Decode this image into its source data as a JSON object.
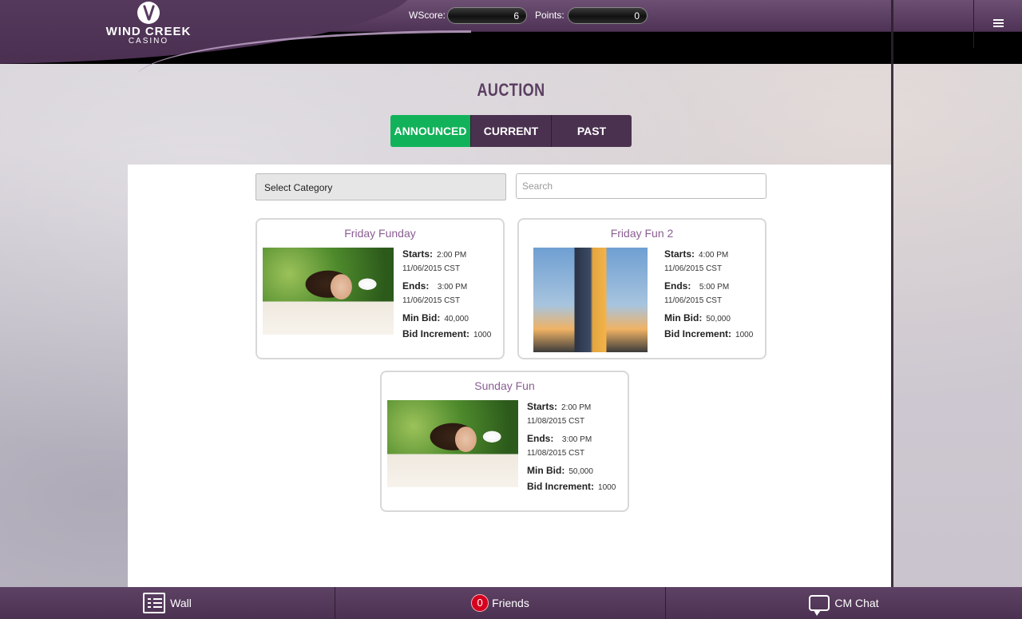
{
  "header": {
    "logo_brand": "WIND CREEK",
    "logo_sub": "CASINO",
    "wscore_label": "WScore:",
    "wscore_value": "6",
    "points_label": "Points:",
    "points_value": "0",
    "menu_icon": "hamburger-menu-icon"
  },
  "auction": {
    "title": "AUCTION",
    "tabs": [
      {
        "label": "ANNOUNCED",
        "active": true
      },
      {
        "label": "CURRENT",
        "active": false
      },
      {
        "label": "PAST",
        "active": false
      }
    ],
    "category_select": "Select Category",
    "search_placeholder": "Search"
  },
  "labels": {
    "starts": "Starts:",
    "ends": "Ends:",
    "min_bid": "Min Bid:",
    "bid_increment": "Bid Increment:"
  },
  "cards": [
    {
      "title": "Friday Funday",
      "image": "spa-woman-image",
      "start_time": "2:00 PM",
      "start_date": "11/06/2015 CST",
      "end_time": "3:00 PM",
      "end_date": "11/06/2015 CST",
      "min_bid": "40,000",
      "bid_increment": "1000"
    },
    {
      "title": "Friday Fun 2",
      "image": "hotel-tower-image",
      "start_time": "4:00 PM",
      "start_date": "11/06/2015 CST",
      "end_time": "5:00 PM",
      "end_date": "11/06/2015 CST",
      "min_bid": "50,000",
      "bid_increment": "1000"
    },
    {
      "title": "Sunday Fun",
      "image": "spa-woman-image",
      "start_time": "2:00 PM",
      "start_date": "11/08/2015 CST",
      "end_time": "3:00 PM",
      "end_date": "11/08/2015 CST",
      "min_bid": "50,000",
      "bid_increment": "1000"
    }
  ],
  "footer": {
    "wall_label": "Wall",
    "friends_count": "0",
    "friends_label": "Friends",
    "chat_label": "CM Chat"
  },
  "colors": {
    "brand_purple": "#4b3150",
    "active_tab_green": "#12b25a",
    "title_purple": "#5b3f62",
    "card_title": "#8a5e92",
    "badge_red": "#d5001f"
  }
}
